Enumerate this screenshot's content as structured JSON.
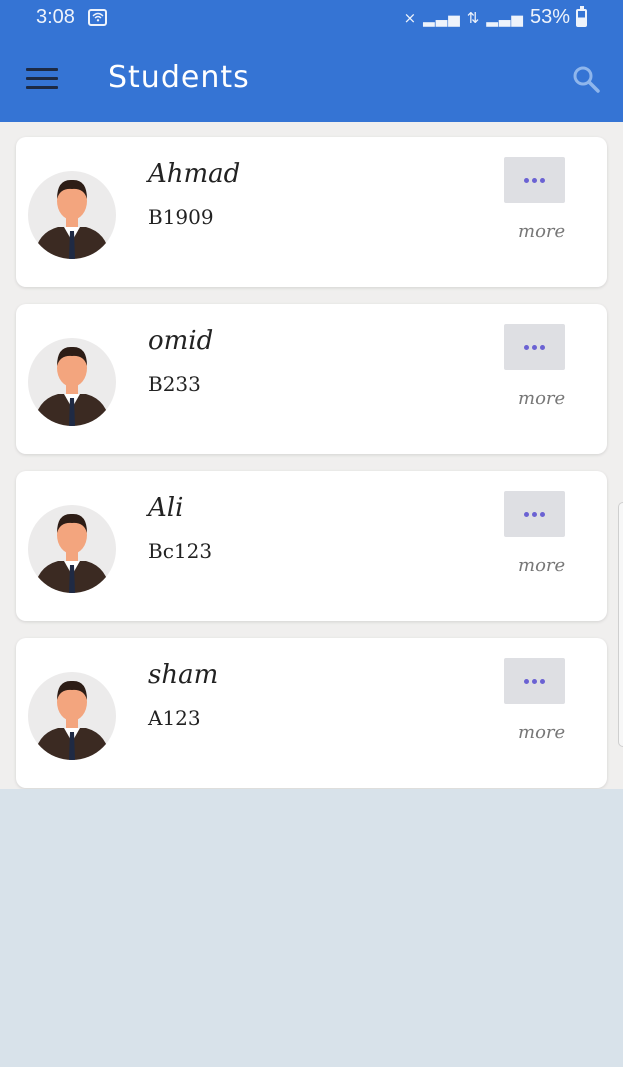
{
  "status_bar": {
    "time": "3:08",
    "battery": "53%"
  },
  "app_bar": {
    "title": "Students",
    "menu_icon": "hamburger-menu-icon",
    "search_icon": "search-icon"
  },
  "students": [
    {
      "name": "Ahmad",
      "code": "B1909",
      "more_label": "more"
    },
    {
      "name": "omid",
      "code": "B233",
      "more_label": "more"
    },
    {
      "name": "Ali",
      "code": "Bc123",
      "more_label": "more"
    },
    {
      "name": "sham",
      "code": "A123",
      "more_label": "more"
    }
  ],
  "colors": {
    "accent": "#3574d4",
    "list_background": "#f0efee",
    "empty_background": "#d8e2ea",
    "more_dots": "#6b62d3"
  }
}
